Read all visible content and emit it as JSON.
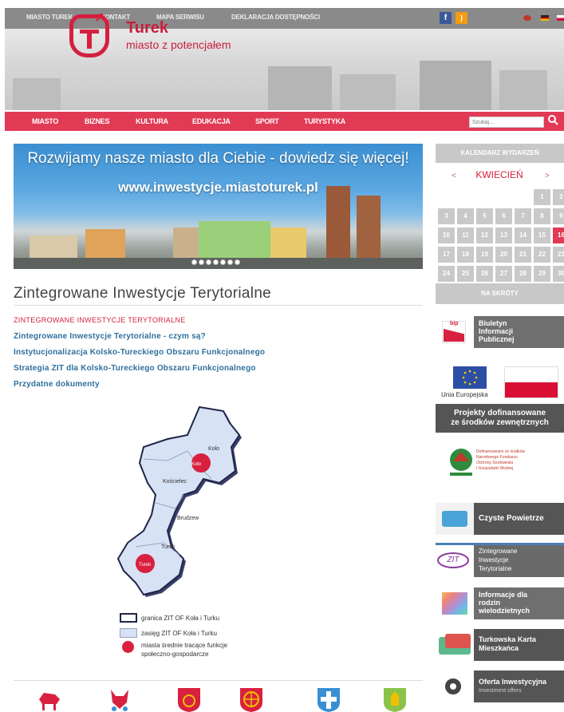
{
  "topbar": {
    "links": [
      "MIASTO TUREK",
      "KONTAKT",
      "MAPA SERWISU",
      "DEKLARACJA DOSTĘPNOŚCI"
    ]
  },
  "header": {
    "logo_title": "Turek",
    "logo_subtitle": "miasto z potencjałem",
    "brand_color": "#d4203f"
  },
  "nav": {
    "items": [
      "MIASTO",
      "BIZNES",
      "KULTURA",
      "EDUKACJA",
      "SPORT",
      "TURYSTYKA"
    ],
    "search_placeholder": "Szukaj..."
  },
  "banner": {
    "line1": "Rozwijamy nasze miasto dla Ciebie - dowiedz się więcej!",
    "line2": "www.inwestycje.miastoturek.pl",
    "slide_count": 7
  },
  "calendar": {
    "title": "KALENDARZ WYDARZEŃ",
    "prev": "<",
    "next": ">",
    "month": "KWIECIEŃ",
    "days": [
      "1",
      "2",
      "3",
      "4",
      "5",
      "6",
      "7",
      "8",
      "9",
      "10",
      "11",
      "12",
      "13",
      "14",
      "15",
      "16",
      "17",
      "18",
      "19",
      "20",
      "21",
      "22",
      "23",
      "24",
      "25",
      "26",
      "27",
      "28",
      "29",
      "30"
    ],
    "today": "16"
  },
  "content": {
    "page_title": "Zintegrowane  Inwestycje Terytorialne",
    "category": "ZINTEGROWANE INWESTYCJE TERYTORIALNE",
    "links": [
      "Zintegrowane Inwestycje Terytorialne  - czym są?",
      "Instytucjonalizacja Kolsko-Tureckiego Obszaru Funkcjonalnego",
      "Strategia ZIT dla Kolsko-Tureckiego Obszaru Funkcjonalnego",
      "Przydatne dokumenty"
    ]
  },
  "map": {
    "places": [
      "Koło",
      "Koło",
      "Kościelec",
      "Brudzew",
      "Turek",
      "Turek"
    ],
    "legend": [
      "granica ZIT OF Koła i Turku",
      "zasięg ZIT OF Koła i Turku",
      "miasta średnie tracące funkcje",
      "społeczno-gospodarcze"
    ]
  },
  "sidebar": {
    "shortcuts_title": "NA SKRÓTY",
    "bip_label": "bip",
    "bip": [
      "Biuletyn",
      "Informacji",
      "Publicznej"
    ],
    "eu_label": "Unia Europejska",
    "eu_projects": [
      "Projekty dofinansowane",
      "ze środków zewnętrznych"
    ],
    "nfos": [
      "Dofinansowano ze środków",
      "Narodowego Funduszu",
      "Ochrony Środowiska",
      "i Gospodarki Wodnej"
    ],
    "clean_air": "Czyste Powietrze",
    "zit_logo": "ZIT",
    "zit": [
      "Zintegrowane",
      "Inwestycje",
      "Terytorialne"
    ],
    "families": [
      "Informacje dla",
      "rodzin",
      "wielodzietnych"
    ],
    "resident_card": [
      "Turkowska Karta",
      "Mieszkańca"
    ],
    "investment": "Oferta Inwestycyjna",
    "investment_sub": "Investment offers"
  }
}
